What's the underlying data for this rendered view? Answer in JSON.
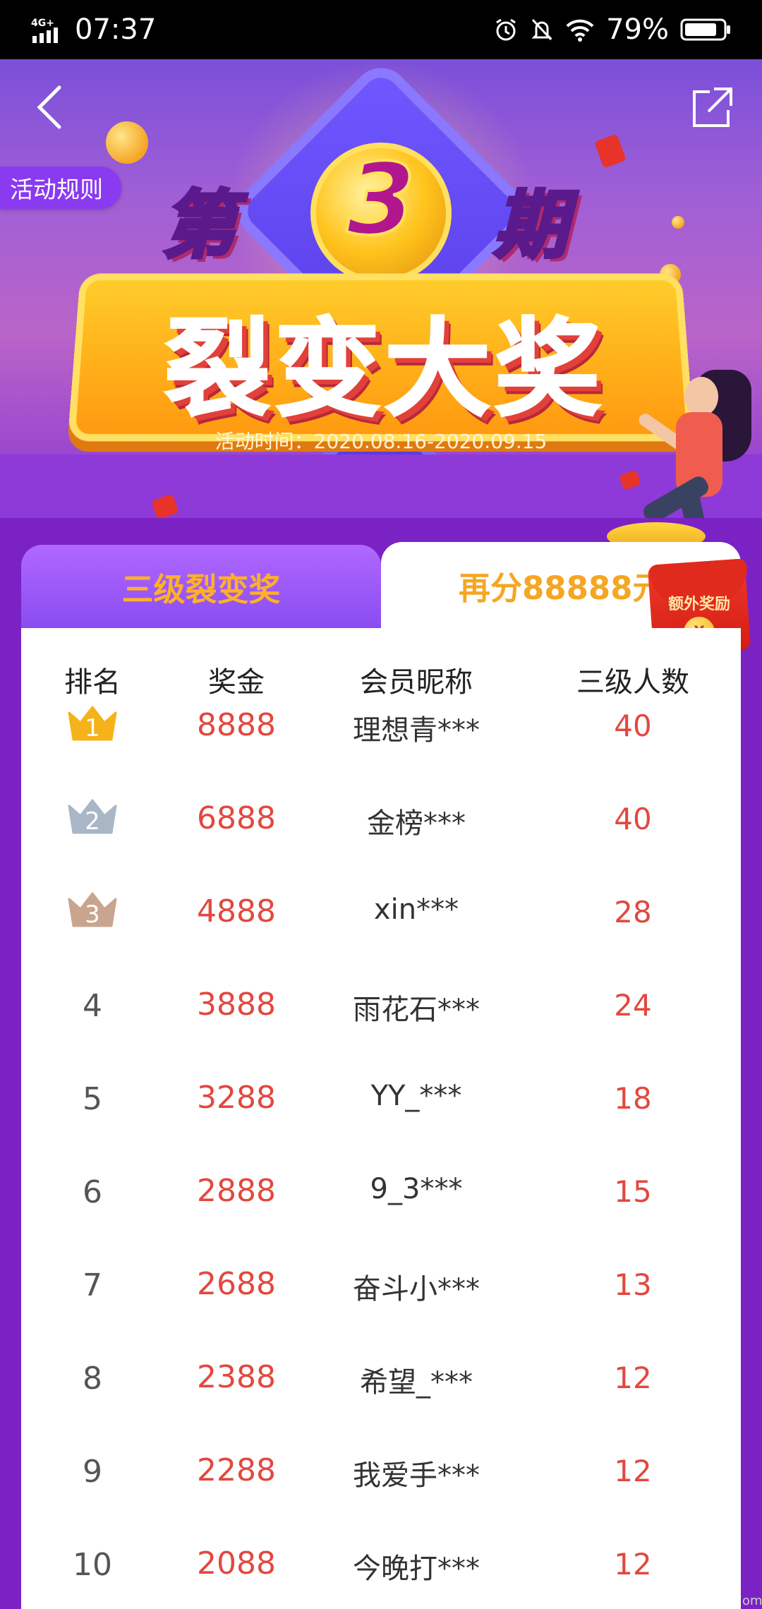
{
  "status_bar": {
    "network": "4G",
    "time": "07:37",
    "battery_percent": "79%"
  },
  "hero": {
    "rules_label": "活动规则",
    "period_prefix": "第",
    "period_number": "3",
    "period_suffix": "期",
    "title": "裂变大奖",
    "event_time": "活动时间：2020.08.16-2020.09.15"
  },
  "tabs": {
    "left_label": "三级裂变奖",
    "right_label": "再分88888元"
  },
  "bonus_badge": {
    "label": "额外奖励",
    "coin_symbol": "¥"
  },
  "table": {
    "headers": [
      "排名",
      "奖金",
      "会员昵称",
      "三级人数"
    ],
    "rows": [
      {
        "rank": "1",
        "bonus": "8888",
        "name": "理想青***",
        "count": "40"
      },
      {
        "rank": "2",
        "bonus": "6888",
        "name": "金榜***",
        "count": "40"
      },
      {
        "rank": "3",
        "bonus": "4888",
        "name": "xin***",
        "count": "28"
      },
      {
        "rank": "4",
        "bonus": "3888",
        "name": "雨花石***",
        "count": "24"
      },
      {
        "rank": "5",
        "bonus": "3288",
        "name": "YY_***",
        "count": "18"
      },
      {
        "rank": "6",
        "bonus": "2888",
        "name": "9_3***",
        "count": "15"
      },
      {
        "rank": "7",
        "bonus": "2688",
        "name": "奋斗小***",
        "count": "13"
      },
      {
        "rank": "8",
        "bonus": "2388",
        "name": "希望_***",
        "count": "12"
      },
      {
        "rank": "9",
        "bonus": "2288",
        "name": "我爱手***",
        "count": "12"
      },
      {
        "rank": "10",
        "bonus": "2088",
        "name": "今晚打***",
        "count": "12"
      }
    ]
  },
  "colors": {
    "background": "#7a22c4",
    "accent_orange": "#f5a623",
    "value_red": "#e2483f",
    "crown_gold": "#f5b21a",
    "crown_silver": "#a9b6c6",
    "crown_bronze": "#c9a48e"
  },
  "icons": {
    "back": "chevron-left-icon",
    "share": "share-icon",
    "alarm": "alarm-icon",
    "mute": "bell-off-icon",
    "wifi": "wifi-icon",
    "battery": "battery-icon"
  }
}
